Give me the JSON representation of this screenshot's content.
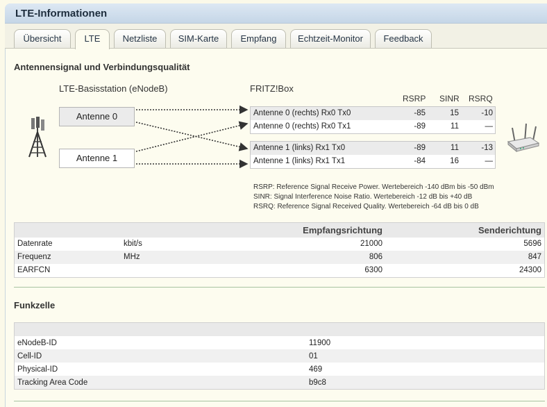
{
  "title": "LTE-Informationen",
  "tabs": [
    "Übersicht",
    "LTE",
    "Netzliste",
    "SIM-Karte",
    "Empfang",
    "Echtzeit-Monitor",
    "Feedback"
  ],
  "active_tab": "LTE",
  "signal": {
    "heading": "Antennensignal und Verbindungsqualität",
    "base_station_label": "LTE-Basisstation (eNodeB)",
    "fritzbox_label": "FRITZ!Box",
    "base_antennas": [
      "Antenne 0",
      "Antenne 1"
    ],
    "columns": [
      "RSRP",
      "SINR",
      "RSRQ"
    ],
    "rows": [
      {
        "name": "Antenne 0 (rechts) Rx0 Tx0",
        "rsrp": "-85",
        "sinr": "15",
        "rsrq": "-10"
      },
      {
        "name": "Antenne 0 (rechts) Rx0 Tx1",
        "rsrp": "-89",
        "sinr": "11",
        "rsrq": "—"
      },
      {
        "name": "Antenne 1 (links) Rx1 Tx0",
        "rsrp": "-89",
        "sinr": "11",
        "rsrq": "-13"
      },
      {
        "name": "Antenne 1 (links) Rx1 Tx1",
        "rsrp": "-84",
        "sinr": "16",
        "rsrq": "—"
      }
    ],
    "legend": [
      "RSRP: Reference Signal Receive Power. Wertebereich -140 dBm bis -50 dBm",
      "SINR: Signal Interference Noise Ratio. Wertebereich -12 dB bis +40 dB",
      "RSRQ: Reference Signal Received Quality. Wertebereich -64 dB bis 0 dB"
    ]
  },
  "rates": {
    "headers": {
      "receive": "Empfangsrichtung",
      "send": "Senderichtung"
    },
    "rows": [
      {
        "label": "Datenrate",
        "unit": "kbit/s",
        "receive": "21000",
        "send": "5696"
      },
      {
        "label": "Frequenz",
        "unit": "MHz",
        "receive": "806",
        "send": "847"
      },
      {
        "label": "EARFCN",
        "unit": "",
        "receive": "6300",
        "send": "24300"
      }
    ]
  },
  "cell": {
    "heading": "Funkzelle",
    "rows": [
      {
        "label": "eNodeB-ID",
        "value": "11900"
      },
      {
        "label": "Cell-ID",
        "value": "01"
      },
      {
        "label": "Physical-ID",
        "value": "469"
      },
      {
        "label": "Tracking Area Code",
        "value": "b9c8"
      }
    ]
  },
  "colors": {
    "title_bar": "#c5d6e7",
    "background": "#fbf9e9",
    "accent_line": "#a7c3a1"
  },
  "icons": {
    "tower": "cell-tower-icon",
    "router": "router-icon"
  }
}
